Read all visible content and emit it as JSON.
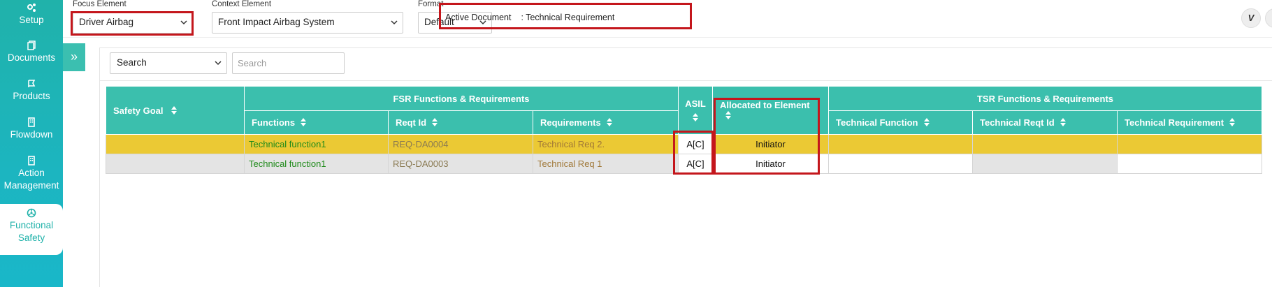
{
  "sidebar": {
    "items": [
      {
        "label": "Setup",
        "icon": "gears-icon"
      },
      {
        "label": "Documents",
        "icon": "documents-icon"
      },
      {
        "label": "Products",
        "icon": "products-icon"
      },
      {
        "label": "Flowdown",
        "icon": "flowdown-icon"
      },
      {
        "label": "Action\nManagement",
        "label_line1": "Action",
        "label_line2": "Management",
        "icon": "action-icon"
      },
      {
        "label_line1": "Functional",
        "label_line2": "Safety",
        "icon": "functional-safety-icon",
        "active": true
      }
    ]
  },
  "topbar": {
    "focus_element": {
      "label": "Focus Element",
      "value": "Driver Airbag"
    },
    "context_element": {
      "label": "Context Element",
      "value": "Front Impact Airbag System"
    },
    "format": {
      "label": "Format",
      "value": "Default"
    },
    "active_document": {
      "label": "Active Document",
      "value": ": Technical Requirement"
    },
    "right_button": {
      "glyph": "V",
      "icon": "vimeo-icon"
    }
  },
  "toolbar": {
    "collapse_glyph": "»",
    "search_select_value": "Search",
    "search_placeholder": "Search"
  },
  "table": {
    "group_headers": {
      "safety_goal": "Safety Goal",
      "fsr": "FSR Functions & Requirements",
      "asil": "ASIL",
      "allocated": "Allocated to Element",
      "tsr": "TSR Functions & Requirements"
    },
    "sub_headers": {
      "functions": "Functions",
      "reqt_id": "Reqt Id",
      "requirements": "Requirements",
      "technical_function": "Technical Function",
      "technical_reqt_id": "Technical Reqt Id",
      "technical_requirement": "Technical Requirement"
    },
    "rows": [
      {
        "safety_goal": "",
        "function": "Technical function1",
        "reqt_id": "REQ-DA0004",
        "requirement": "Technical Req 2.",
        "asil": "A[C]",
        "allocated": "Initiator",
        "tech_function": "",
        "tech_reqt_id": "",
        "tech_requirement": ""
      },
      {
        "safety_goal": "",
        "function": "Technical function1",
        "reqt_id": "REQ-DA0003",
        "requirement": "Technical Req 1",
        "asil": "A[C]",
        "allocated": "Initiator",
        "tech_function": "",
        "tech_reqt_id": "",
        "tech_requirement": ""
      }
    ]
  },
  "colors": {
    "sidebar": "#20b2aa",
    "header": "#3bbfad",
    "highlight_row": "#ebc934",
    "annotation_box": "#c4161c"
  }
}
